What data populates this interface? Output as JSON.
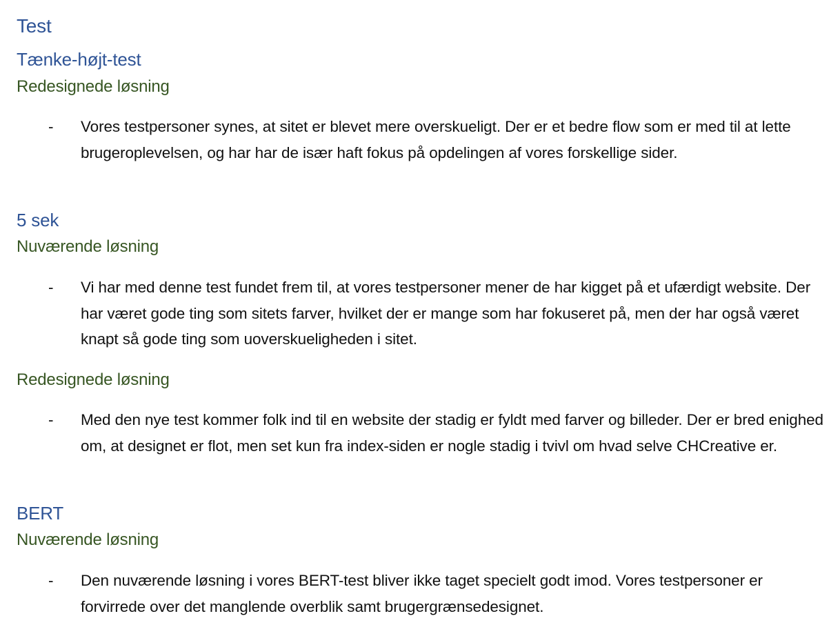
{
  "sections": {
    "test": "Test",
    "thinkaloud": "Tænke-højt-test",
    "thinkaloud_redesign": "Redesignede løsning",
    "bullet1": "Vores testpersoner synes, at sitet er blevet mere overskueligt. Der er et bedre flow som er med til at lette brugeroplevelsen, og har har de især haft fokus på opdelingen af vores forskellige sider.",
    "fivesec": "5 sek",
    "fivesec_current": "Nuværende løsning",
    "bullet2": "Vi har med denne test fundet frem til, at vores testpersoner mener de har kigget på et ufærdigt website. Der har været gode ting som sitets farver, hvilket der er mange som har fokuseret på, men der har også været knapt så gode ting som uoverskueligheden i sitet.",
    "fivesec_redesign": "Redesignede løsning",
    "bullet3": "Med den nye test kommer folk ind til en website der stadig er fyldt med farver og billeder. Der er bred enighed om, at designet er flot, men set kun fra index-siden er nogle stadig i tvivl om hvad selve CHCreative er.",
    "bert": "BERT",
    "bert_current": "Nuværende løsning",
    "bullet4": "Den nuværende løsning i vores BERT-test bliver ikke taget specielt godt imod. Vores testpersoner er forvirrede over det manglende overblik samt brugergrænsedesignet."
  },
  "bullet_marker": "-",
  "colors": {
    "heading_blue": "#2f5496",
    "heading_green": "#375623",
    "body_text": "#111111"
  }
}
